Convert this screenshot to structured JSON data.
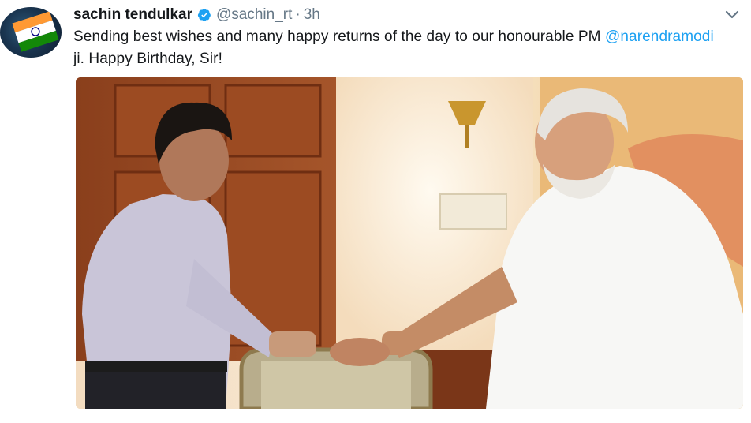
{
  "tweet": {
    "author_name": "sachin tendulkar",
    "handle": "@sachin_rt",
    "separator": "·",
    "timestamp": "3h",
    "verified": true,
    "text_part1": "Sending best wishes and many happy returns of the day to our honourable PM ",
    "mention": "@narendramodi",
    "text_part2": " ji. Happy Birthday, Sir!",
    "avatar_icon": "profile-avatar",
    "menu_icon": "chevron-down-icon",
    "colors": {
      "link": "#1da1f2",
      "muted": "#657786",
      "text": "#14171a",
      "verified": "#1da1f2"
    }
  }
}
